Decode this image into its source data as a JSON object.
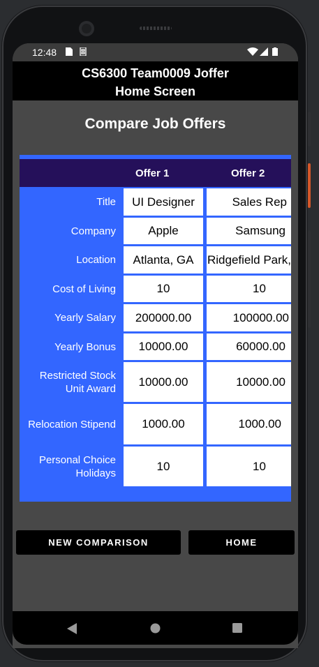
{
  "status": {
    "time": "12:48"
  },
  "appbar": {
    "line1": "CS6300 Team0009 Joffer",
    "line2": "Home Screen"
  },
  "heading": "Compare Job Offers",
  "table": {
    "headers": [
      "",
      "Offer 1",
      "Offer 2"
    ],
    "rows": [
      {
        "label": "Title",
        "offer1": "UI Designer",
        "offer2": "Sales Rep"
      },
      {
        "label": "Company",
        "offer1": "Apple",
        "offer2": "Samsung"
      },
      {
        "label": "Location",
        "offer1": "Atlanta, GA",
        "offer2": "Ridgefield Park,"
      },
      {
        "label": "Cost of Living",
        "offer1": "10",
        "offer2": "10"
      },
      {
        "label": "Yearly Salary",
        "offer1": "200000.00",
        "offer2": "100000.00"
      },
      {
        "label": "Yearly Bonus",
        "offer1": "10000.00",
        "offer2": "60000.00"
      },
      {
        "label": "Restricted Stock Unit Award",
        "offer1": "10000.00",
        "offer2": "10000.00"
      },
      {
        "label": "Relocation Stipend",
        "offer1": "1000.00",
        "offer2": "1000.00"
      },
      {
        "label": "Personal Choice Holidays",
        "offer1": "10",
        "offer2": "10"
      }
    ]
  },
  "buttons": {
    "new_comparison": "NEW COMPARISON",
    "home": "HOME"
  },
  "icons": {
    "status": [
      "sim-card-icon",
      "sd-card-icon",
      "wifi-icon",
      "cell-signal-icon",
      "battery-icon"
    ],
    "nav": [
      "back-icon",
      "home-icon",
      "recents-icon"
    ]
  },
  "colors": {
    "table_bg": "#3366ff",
    "header_bg": "#25105a",
    "appbar_bg": "#000000",
    "screen_bg": "#484848"
  }
}
